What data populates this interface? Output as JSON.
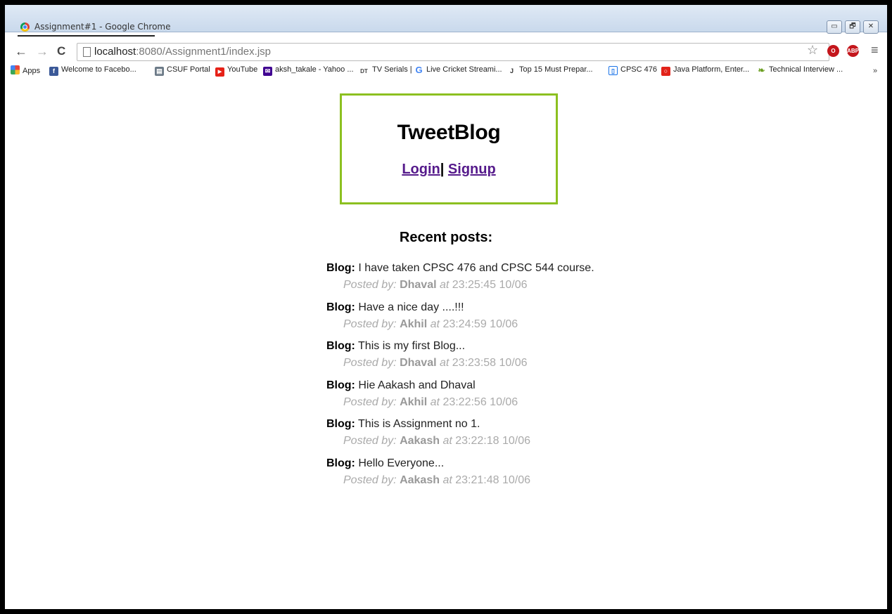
{
  "window": {
    "title": "Assignment#1 - Google Chrome",
    "buttons": {
      "minimize": "▭",
      "restore": "🗗",
      "close": "✕"
    }
  },
  "toolbar": {
    "back": "←",
    "forward": "→",
    "reload": "C",
    "url_host": "localhost",
    "url_path": ":8080/Assignment1/index.jsp",
    "star": "☆",
    "abp_label": "ABP",
    "menu": "≡"
  },
  "bookmarks": [
    {
      "label": "Apps",
      "icon": "apps-grid-icon",
      "color": "#e8453c"
    },
    {
      "label": "Welcome to Facebo...",
      "icon": "facebook-icon",
      "color": "#3b5998",
      "glyph": "f"
    },
    {
      "label": "CSUF Portal",
      "icon": "portal-icon",
      "color": "#6d7b88",
      "glyph": "▤"
    },
    {
      "label": "YouTube",
      "icon": "youtube-icon",
      "color": "#e62117",
      "glyph": "▶"
    },
    {
      "label": "aksh_takale - Yahoo ...",
      "icon": "yahoo-mail-icon",
      "color": "#400191",
      "glyph": "✉"
    },
    {
      "label": "TV Serials |",
      "icon": "tv-serials-icon",
      "color": "#555555",
      "glyph": "DT"
    },
    {
      "label": "Live Cricket Streami...",
      "icon": "google-icon",
      "color": "#4285f4",
      "glyph": "G"
    },
    {
      "label": "Top 15 Must Prepar...",
      "icon": "jm-icon",
      "color": "#333333",
      "glyph": "J"
    },
    {
      "label": "CPSC 476",
      "icon": "docs-icon",
      "color": "#1a73e8",
      "glyph": "▯"
    },
    {
      "label": "Java Platform, Enter...",
      "icon": "oracle-icon",
      "color": "#e2231a",
      "glyph": "○"
    },
    {
      "label": "Technical Interview ...",
      "icon": "leaf-icon",
      "color": "#6a9e1f",
      "glyph": "❧"
    }
  ],
  "bookmarks_more": "»",
  "page": {
    "site_title": "TweetBlog",
    "login": "Login",
    "separator": "|",
    "signup": "Signup",
    "recent_title": "Recent posts:",
    "blog_label": "Blog:",
    "posted_by": "Posted by:",
    "at": "at",
    "posts": [
      {
        "text": "I have taken CPSC 476 and CPSC 544 course.",
        "author": "Dhaval",
        "time": "23:25:45 10/06"
      },
      {
        "text": "Have a nice day ....!!!",
        "author": "Akhil",
        "time": "23:24:59 10/06"
      },
      {
        "text": "This is my first Blog...",
        "author": "Dhaval",
        "time": "23:23:58 10/06"
      },
      {
        "text": "Hie Aakash and Dhaval",
        "author": "Akhil",
        "time": "23:22:56 10/06"
      },
      {
        "text": "This is Assignment no 1.",
        "author": "Aakash",
        "time": "23:22:18 10/06"
      },
      {
        "text": "Hello Everyone...",
        "author": "Aakash",
        "time": "23:21:48 10/06"
      }
    ]
  },
  "colors": {
    "box_border": "#8cc020",
    "link": "#551a8b"
  }
}
